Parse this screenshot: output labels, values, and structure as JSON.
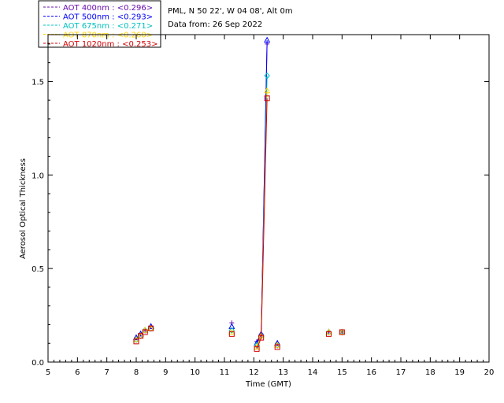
{
  "chart_data": {
    "type": "scatter",
    "header": {
      "location": "PML, N 50 22', W 04 08', Alt 0m",
      "date": "Data from: 26 Sep 2022"
    },
    "xlabel": "Time (GMT)",
    "ylabel": "Aerosol Optical Thickness",
    "xlim": [
      5,
      20
    ],
    "ylim": [
      0,
      1.75
    ],
    "x_ticks": [
      "5",
      "6",
      "7",
      "8",
      "9",
      "10",
      "11",
      "12",
      "13",
      "14",
      "15",
      "16",
      "17",
      "18",
      "19",
      "20"
    ],
    "y_ticks": [
      "0.0",
      "0.5",
      "1.0",
      "1.5"
    ],
    "legend_position": "top-left",
    "series": [
      {
        "name": "AOT  400nm : <0.296>",
        "color": "#6a0dad",
        "marker": "plus",
        "x": [
          8.0,
          8.15,
          8.3,
          8.5,
          11.25,
          12.1,
          12.25,
          12.45,
          12.8,
          14.55,
          15.0
        ],
        "y": [
          0.13,
          0.15,
          0.17,
          0.19,
          0.21,
          0.11,
          0.15,
          1.7,
          0.1,
          0.16,
          0.16
        ]
      },
      {
        "name": "AOT  500nm : <0.293>",
        "color": "#0000ff",
        "marker": "triangle",
        "x": [
          8.0,
          8.15,
          8.3,
          8.5,
          11.25,
          12.1,
          12.25,
          12.45,
          12.8,
          14.55,
          15.0
        ],
        "y": [
          0.13,
          0.15,
          0.17,
          0.19,
          0.19,
          0.1,
          0.15,
          1.72,
          0.1,
          0.16,
          0.16
        ]
      },
      {
        "name": "AOT  675nm : <0.271>",
        "color": "#00c0c0",
        "marker": "diamond",
        "x": [
          8.0,
          8.15,
          8.3,
          8.5,
          11.25,
          12.1,
          12.25,
          12.45,
          12.8,
          14.55,
          15.0
        ],
        "y": [
          0.12,
          0.14,
          0.17,
          0.18,
          0.17,
          0.09,
          0.14,
          1.53,
          0.09,
          0.16,
          0.16
        ]
      },
      {
        "name": "AOT  870nm : <0.260>",
        "color": "#ffd700",
        "marker": "triangle",
        "x": [
          8.0,
          8.15,
          8.3,
          8.5,
          11.25,
          12.1,
          12.25,
          12.45,
          12.8,
          14.55,
          15.0
        ],
        "y": [
          0.12,
          0.14,
          0.17,
          0.18,
          0.16,
          0.08,
          0.14,
          1.45,
          0.09,
          0.16,
          0.16
        ]
      },
      {
        "name": "AOT 1020nm : <0.253>",
        "color": "#d40000",
        "marker": "square",
        "x": [
          8.0,
          8.15,
          8.3,
          8.5,
          11.25,
          12.1,
          12.25,
          12.45,
          12.8,
          14.55,
          15.0
        ],
        "y": [
          0.11,
          0.14,
          0.16,
          0.18,
          0.15,
          0.07,
          0.13,
          1.41,
          0.08,
          0.15,
          0.16
        ]
      }
    ]
  }
}
